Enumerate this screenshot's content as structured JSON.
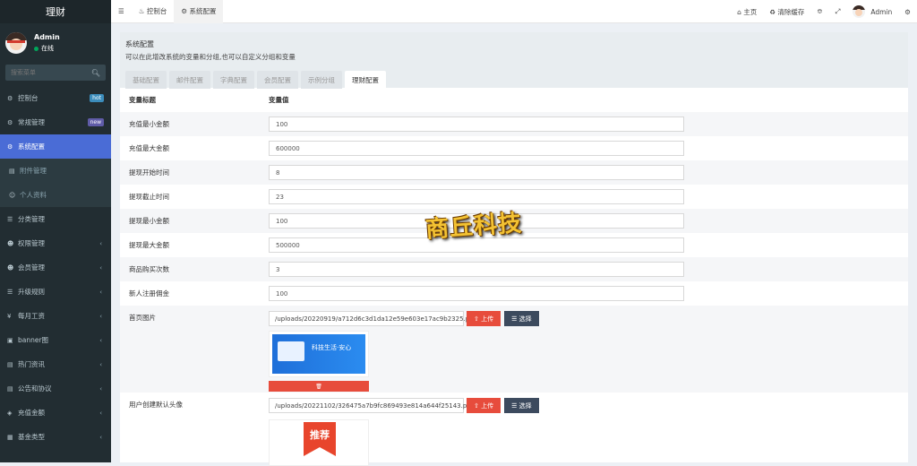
{
  "sidebar": {
    "brand": "理财",
    "user": {
      "name": "Admin",
      "status": "在线"
    },
    "search_placeholder": "搜索菜单",
    "items": [
      {
        "label": "控制台",
        "icon": "dashboard-icon",
        "badge": "hot",
        "badge_color": "#3c8dbc"
      },
      {
        "label": "常规管理",
        "icon": "cogs-icon",
        "badge": "new",
        "badge_color": "#605ca8"
      },
      {
        "label": "系统配置",
        "icon": "gear-icon",
        "active": true
      },
      {
        "label": "附件管理",
        "icon": "file-icon",
        "sub": true
      },
      {
        "label": "个人资料",
        "icon": "user-icon",
        "sub": true
      },
      {
        "label": "分类管理",
        "icon": "list-icon"
      },
      {
        "label": "权限管理",
        "icon": "group-icon",
        "arrow": true
      },
      {
        "label": "会员管理",
        "icon": "users-icon",
        "arrow": true
      },
      {
        "label": "升级规则",
        "icon": "rule-icon",
        "arrow": true
      },
      {
        "label": "每月工资",
        "icon": "yen-icon",
        "arrow": true
      },
      {
        "label": "banner图",
        "icon": "image-icon",
        "arrow": true
      },
      {
        "label": "热门资讯",
        "icon": "news-icon",
        "arrow": true
      },
      {
        "label": "公告和协议",
        "icon": "notice-icon",
        "arrow": true
      },
      {
        "label": "充值金额",
        "icon": "money-icon",
        "arrow": true
      },
      {
        "label": "基金类型",
        "icon": "fund-icon",
        "arrow": true
      }
    ]
  },
  "topbar": {
    "menu_icon": "hamburger-icon",
    "tabs": [
      {
        "label": "控制台",
        "icon": "dashboard-icon"
      },
      {
        "label": "系统配置",
        "icon": "gear-icon",
        "active": true
      }
    ],
    "right": {
      "home": "主页",
      "clear_cache": "清除缓存",
      "admin": "Admin"
    }
  },
  "panel": {
    "title": "系统配置",
    "desc": "可以在此增改系统的变量和分组,也可以自定义分组和变量",
    "tabs": [
      "基础配置",
      "邮件配置",
      "字典配置",
      "会员配置",
      "示例分组",
      "理财配置"
    ],
    "active_tab": "理财配置",
    "headers": {
      "name": "变量标题",
      "value": "变量值"
    },
    "rows": [
      {
        "label": "充值最小金额",
        "value": "100"
      },
      {
        "label": "充值最大金额",
        "value": "600000"
      },
      {
        "label": "提现开始时间",
        "value": "8"
      },
      {
        "label": "提现截止时间",
        "value": "23"
      },
      {
        "label": "提现最小金额",
        "value": "100"
      },
      {
        "label": "提现最大金额",
        "value": "500000"
      },
      {
        "label": "商品购买次数",
        "value": "3"
      },
      {
        "label": "新人注册佣金",
        "value": "100"
      }
    ],
    "image_rows": [
      {
        "label": "首页图片",
        "path": "/uploads/20220919/a712d6c3d1da12e59e603e17ac9b2325.png",
        "upload": "上传",
        "select": "选择",
        "thumb_text": "科技生活·安心",
        "delete_icon": "trash-icon"
      },
      {
        "label": "用户创建默认头像",
        "path": "/uploads/20221102/326475a7b9fc869493e814a644f25143.png",
        "upload": "上传",
        "select": "选择",
        "thumb_text": "推荐"
      }
    ]
  },
  "watermark": "商丘科技"
}
